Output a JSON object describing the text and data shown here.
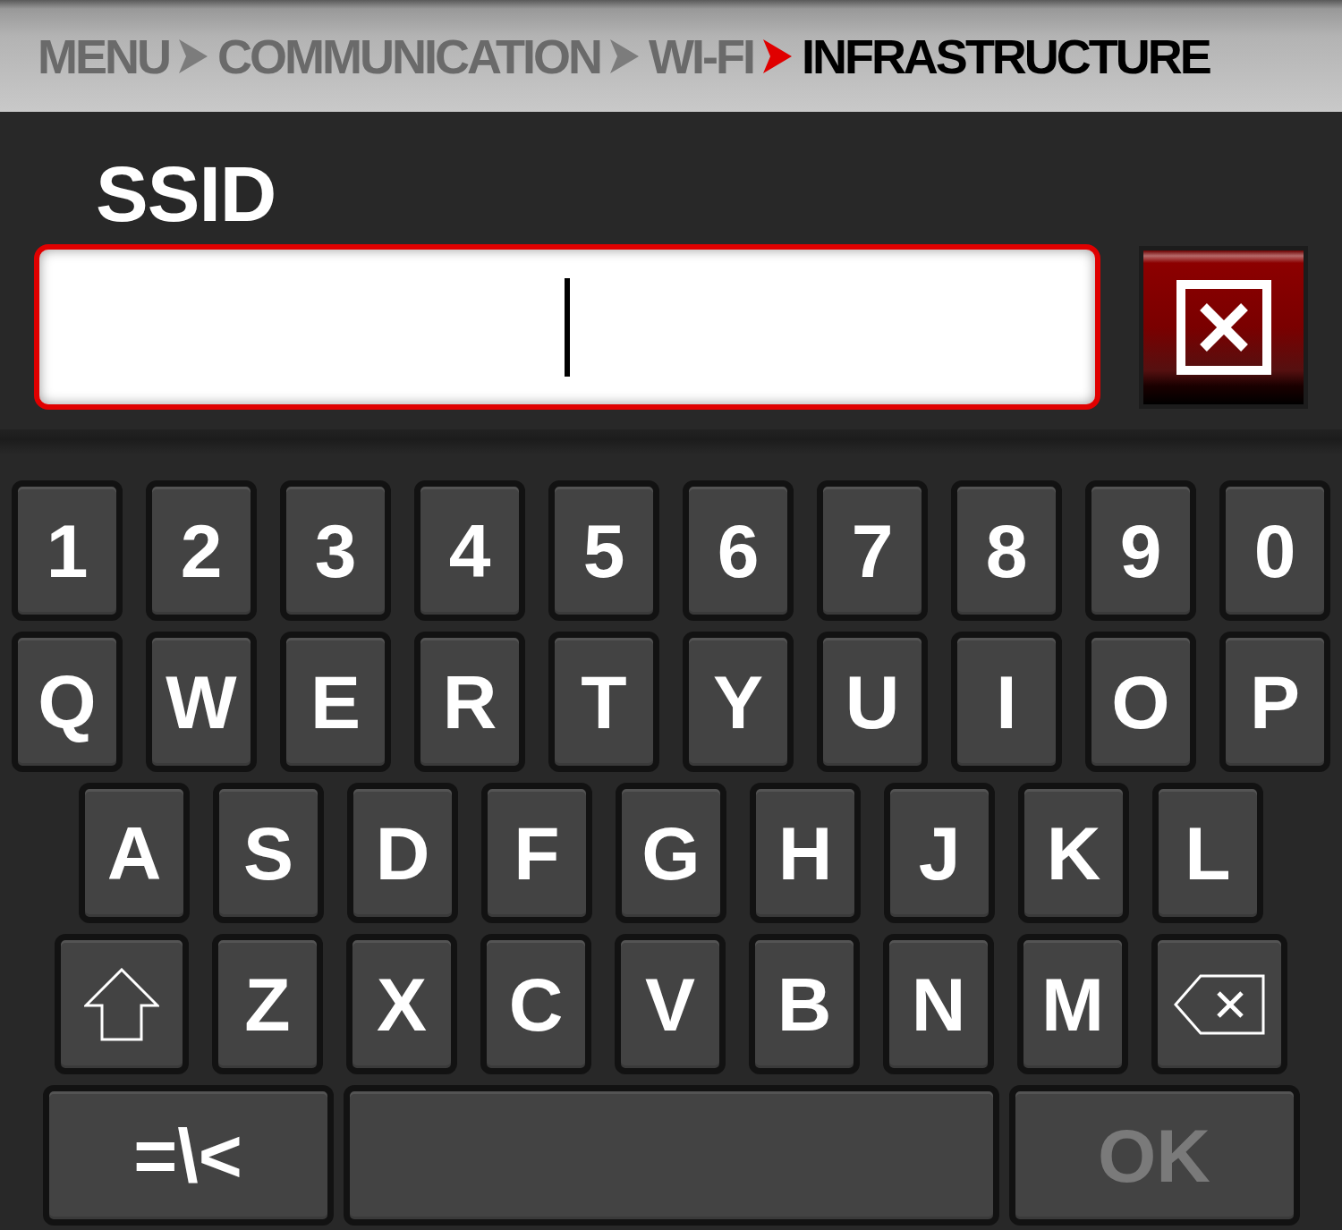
{
  "breadcrumb": [
    {
      "label": "MENU",
      "current": false
    },
    {
      "label": "COMMUNICATION",
      "current": false
    },
    {
      "label": "WI-FI",
      "current": false
    },
    {
      "label": "INFRASTRUCTURE",
      "current": true
    }
  ],
  "ssid": {
    "label": "SSID",
    "focused": true
  },
  "keyboard": {
    "rows": [
      {
        "keys": [
          {
            "kind": "char",
            "label": "1",
            "disabled": false
          },
          {
            "kind": "char",
            "label": "2",
            "disabled": false
          },
          {
            "kind": "char",
            "label": "3",
            "disabled": false
          },
          {
            "kind": "char",
            "label": "4",
            "disabled": false
          },
          {
            "kind": "char",
            "label": "5",
            "disabled": false
          },
          {
            "kind": "char",
            "label": "6",
            "disabled": false
          },
          {
            "kind": "char",
            "label": "7",
            "disabled": false
          },
          {
            "kind": "char",
            "label": "8",
            "disabled": false
          },
          {
            "kind": "char",
            "label": "9",
            "disabled": false
          },
          {
            "kind": "char",
            "label": "0",
            "disabled": false
          }
        ]
      },
      {
        "keys": [
          {
            "kind": "char",
            "label": "Q",
            "disabled": false
          },
          {
            "kind": "char",
            "label": "W",
            "disabled": false
          },
          {
            "kind": "char",
            "label": "E",
            "disabled": false
          },
          {
            "kind": "char",
            "label": "R",
            "disabled": false
          },
          {
            "kind": "char",
            "label": "T",
            "disabled": false
          },
          {
            "kind": "char",
            "label": "Y",
            "disabled": false
          },
          {
            "kind": "char",
            "label": "U",
            "disabled": false
          },
          {
            "kind": "char",
            "label": "I",
            "disabled": false
          },
          {
            "kind": "char",
            "label": "O",
            "disabled": false
          },
          {
            "kind": "char",
            "label": "P",
            "disabled": false
          }
        ]
      },
      {
        "keys": [
          {
            "kind": "char",
            "label": "A",
            "disabled": false
          },
          {
            "kind": "char",
            "label": "S",
            "disabled": false
          },
          {
            "kind": "char",
            "label": "D",
            "disabled": false
          },
          {
            "kind": "char",
            "label": "F",
            "disabled": false
          },
          {
            "kind": "char",
            "label": "G",
            "disabled": false
          },
          {
            "kind": "char",
            "label": "H",
            "disabled": false
          },
          {
            "kind": "char",
            "label": "J",
            "disabled": false
          },
          {
            "kind": "char",
            "label": "K",
            "disabled": false
          },
          {
            "kind": "char",
            "label": "L",
            "disabled": false
          }
        ]
      },
      {
        "keys": [
          {
            "kind": "shift",
            "disabled": false
          },
          {
            "kind": "char",
            "label": "Z",
            "disabled": false
          },
          {
            "kind": "char",
            "label": "X",
            "disabled": false
          },
          {
            "kind": "char",
            "label": "C",
            "disabled": false
          },
          {
            "kind": "char",
            "label": "V",
            "disabled": false
          },
          {
            "kind": "char",
            "label": "B",
            "disabled": false
          },
          {
            "kind": "char",
            "label": "N",
            "disabled": false
          },
          {
            "kind": "char",
            "label": "M",
            "disabled": false
          },
          {
            "kind": "backspace",
            "disabled": false
          }
        ]
      },
      {
        "keys": [
          {
            "kind": "mode",
            "label": "=\\<",
            "disabled": false
          },
          {
            "kind": "space"
          },
          {
            "kind": "action",
            "label": "OK",
            "disabled": true
          }
        ]
      }
    ]
  }
}
